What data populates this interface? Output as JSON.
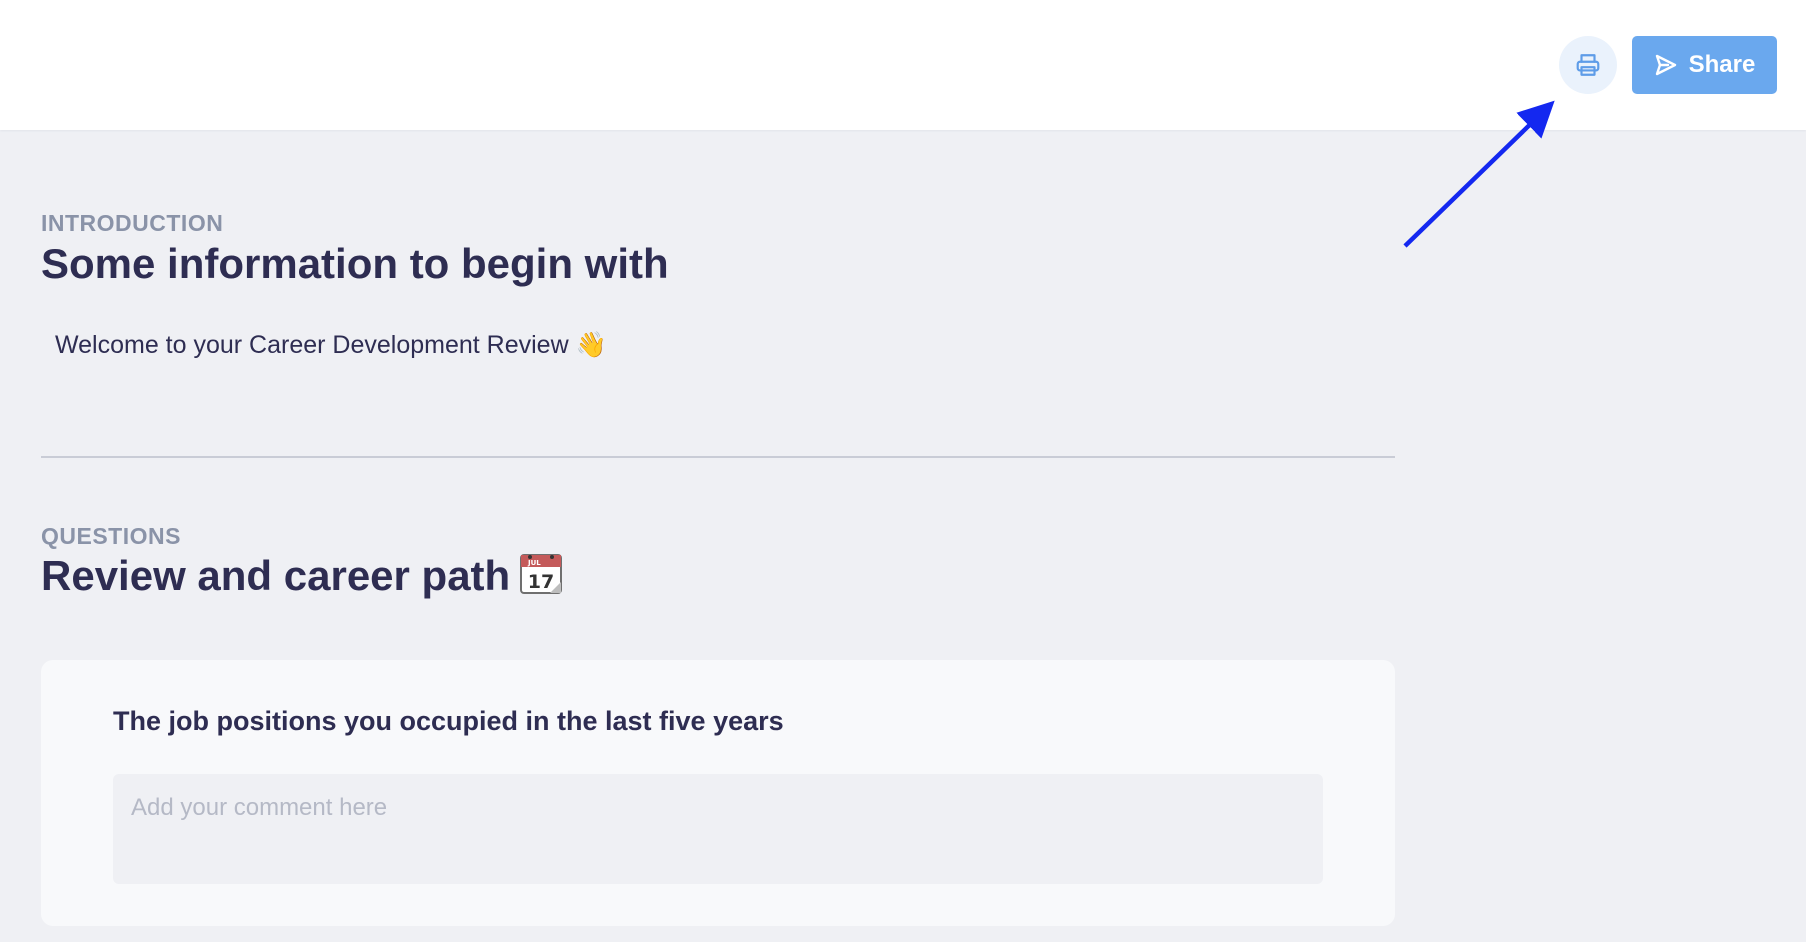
{
  "header": {
    "share_label": "Share",
    "print_icon": "printer-icon",
    "share_icon": "send-icon"
  },
  "introduction": {
    "label": "INTRODUCTION",
    "title": "Some information to begin with",
    "text": "Welcome to your Career Development Review 👋"
  },
  "questions": {
    "label": "QUESTIONS",
    "title": "Review and career path",
    "title_icon": "calendar-icon",
    "calendar_month": "JUL",
    "calendar_day": "17",
    "items": [
      {
        "question": "The job positions you occupied in the last five years",
        "placeholder": "Add your comment here",
        "value": ""
      }
    ]
  },
  "colors": {
    "accent": "#6aa8ee",
    "text_dark": "#2e2d52",
    "label_gray": "#8a93a8",
    "page_bg": "#eff0f4",
    "annotation_arrow": "#1428f0"
  }
}
